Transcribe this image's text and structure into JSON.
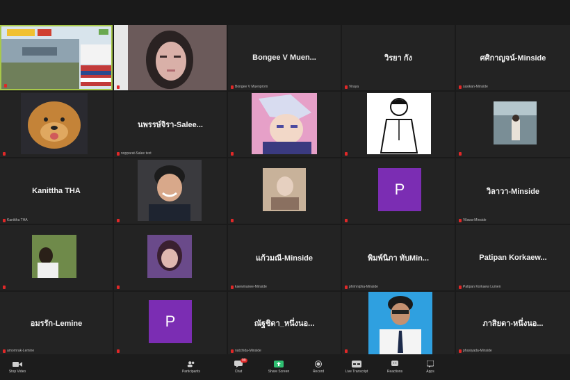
{
  "tiles": [
    {
      "name": "",
      "sub": "",
      "video": "slides"
    },
    {
      "name": "",
      "sub": "",
      "video": "face-long-hair"
    },
    {
      "name": "Bongee V Muen...",
      "sub": "Bongee V Muenprom"
    },
    {
      "name": "วิรยา กัง",
      "sub": "Viraya"
    },
    {
      "name": "ศศิกาญจน์-Minside",
      "sub": "sasikan-Minside"
    },
    {
      "name": "",
      "sub": "",
      "video": "dog"
    },
    {
      "name": "นพรรษ์จิรา-Salee...",
      "sub": "nopparat-Salee text"
    },
    {
      "name": "",
      "sub": "",
      "video": "anime"
    },
    {
      "name": "",
      "sub": "",
      "video": "sketch"
    },
    {
      "name": "",
      "sub": "",
      "video": "outdoor"
    },
    {
      "name": "Kanittha THA",
      "sub": "Kanittha THA"
    },
    {
      "name": "",
      "sub": "",
      "video": "smiling-man"
    },
    {
      "name": "",
      "sub": "",
      "video": "person-frame"
    },
    {
      "name": "",
      "sub": "",
      "avatar": "P"
    },
    {
      "name": "วิลาวา-Minside",
      "sub": "Vilawa-Minside"
    },
    {
      "name": "",
      "sub": "",
      "video": "garden"
    },
    {
      "name": "",
      "sub": "",
      "video": "woman-purple"
    },
    {
      "name": "แก้วมณี-Minside",
      "sub": "kaewmanee-Minside"
    },
    {
      "name": "พิมพ์นิภา ทับMin...",
      "sub": "phimnipha-Minside"
    },
    {
      "name": "Patipan Korkaew...",
      "sub": "Patipan Korkaew Lumen"
    },
    {
      "name": "อมรรัก-Lemine",
      "sub": "amornrak-Lemine"
    },
    {
      "name": "",
      "sub": "",
      "avatar": "P"
    },
    {
      "name": "ณัฐชิดา_หนึ่งนอ...",
      "sub": "natchida-Minside"
    },
    {
      "name": "",
      "sub": "",
      "video": "man-shirt"
    },
    {
      "name": "ภาสิยดา-หนึ่งนอ...",
      "sub": "phasiyada-Minside"
    }
  ],
  "toolbar": {
    "stop_video": "Stop Video",
    "participants": "Participants",
    "chat": "Chat",
    "chat_badge": "99",
    "share_screen": "Share Screen",
    "record": "Record",
    "live_transcript": "Live Transcript",
    "reactions": "Reactions",
    "apps": "Apps"
  },
  "colors": {
    "accent": "#a8c84a",
    "share": "#2fbf71",
    "avatar": "#7b2db3"
  }
}
